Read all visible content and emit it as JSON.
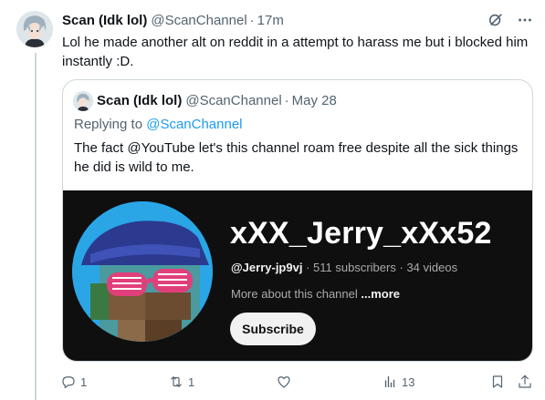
{
  "tweet": {
    "author_name": "Scan (Idk lol)",
    "author_handle": "@ScanChannel",
    "separator": "·",
    "time": "17m",
    "text": "Lol he made another alt on reddit in a attempt to harass me but i blocked him instantly :D."
  },
  "quoted": {
    "author_name": "Scan (Idk lol)",
    "author_handle": "@ScanChannel",
    "separator": "·",
    "date": "May 28",
    "replying_prefix": "Replying to",
    "replying_handle": "@ScanChannel",
    "text": "The fact @YouTube let's this channel roam free despite all the sick things he did is wild to me.",
    "youtube_card": {
      "channel_name": "xXX_Jerry_xXx52",
      "channel_handle": "@Jerry-jp9vj",
      "separator": "·",
      "subscribers": "511 subscribers",
      "videos": "34 videos",
      "about_text": "More about this channel",
      "more_label": "...more",
      "subscribe_label": "Subscribe"
    }
  },
  "actions": {
    "reply_count": "1",
    "retweet_count": "1",
    "like_count": "",
    "views_count": "13"
  },
  "colors": {
    "text_primary": "#0f1419",
    "text_secondary": "#536471",
    "accent": "#1d9bf0",
    "border": "#cfd9de",
    "yt_background": "#0f0f0f"
  },
  "icons": [
    "grok-icon",
    "more-icon",
    "reply-icon",
    "retweet-icon",
    "like-icon",
    "views-icon",
    "bookmark-icon",
    "share-icon"
  ]
}
